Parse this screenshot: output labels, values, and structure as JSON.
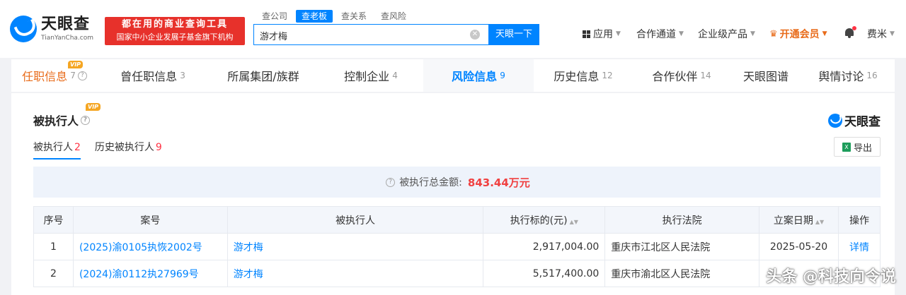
{
  "header": {
    "logo_cn": "天眼查",
    "logo_en": "TianYanCha.com",
    "slogan_line1": "都在用的商业查询工具",
    "slogan_line2": "国家中小企业发展子基金旗下机构",
    "search_tabs": [
      "查公司",
      "查老板",
      "查关系",
      "查风险"
    ],
    "search_active_tab": "查老板",
    "search_value": "游才梅",
    "search_button": "天眼一下",
    "nav": {
      "app": "应用",
      "channel": "合作通道",
      "enterprise": "企业级产品",
      "vip": "开通会员",
      "user": "费米"
    }
  },
  "tabs": [
    {
      "label": "任职信息",
      "count": "7",
      "vip": "VIP"
    },
    {
      "label": "曾任职信息",
      "count": "3"
    },
    {
      "label": "所属集团/族群",
      "count": ""
    },
    {
      "label": "控制企业",
      "count": "4"
    },
    {
      "label": "风险信息",
      "count": "9"
    },
    {
      "label": "历史信息",
      "count": "12"
    },
    {
      "label": "合作伙伴",
      "count": "14"
    },
    {
      "label": "天眼图谱",
      "count": ""
    },
    {
      "label": "舆情讨论",
      "count": "16"
    }
  ],
  "section": {
    "title": "被执行人",
    "vip": "VIP",
    "brand": "天眼查",
    "subtabs": [
      {
        "label": "被执行人",
        "count": "2"
      },
      {
        "label": "历史被执行人",
        "count": "9"
      }
    ],
    "export": "导出",
    "excel_glyph": "X",
    "summary_label": "被执行总金额:",
    "summary_amount": "843.44万元"
  },
  "table": {
    "headers": [
      "序号",
      "案号",
      "被执行人",
      "执行标的(元)",
      "执行法院",
      "立案日期",
      "操作"
    ],
    "rows": [
      {
        "no": "1",
        "case": "(2025)渝0105执恢2002号",
        "person": "游才梅",
        "amount": "2,917,004.00",
        "court": "重庆市江北区人民法院",
        "date": "2025-05-20",
        "action": "详情"
      },
      {
        "no": "2",
        "case": "(2024)渝0112执27969号",
        "person": "游才梅",
        "amount": "5,517,400.00",
        "court": "重庆市渝北区人民法院",
        "date": "",
        "action": ""
      }
    ]
  },
  "watermark": "头条 @科技向令说",
  "colors": {
    "brand_blue": "#0084ff",
    "slogan_red": "#e7312b",
    "vip_orange": "#e86b1a",
    "amount_red": "#f04040"
  }
}
